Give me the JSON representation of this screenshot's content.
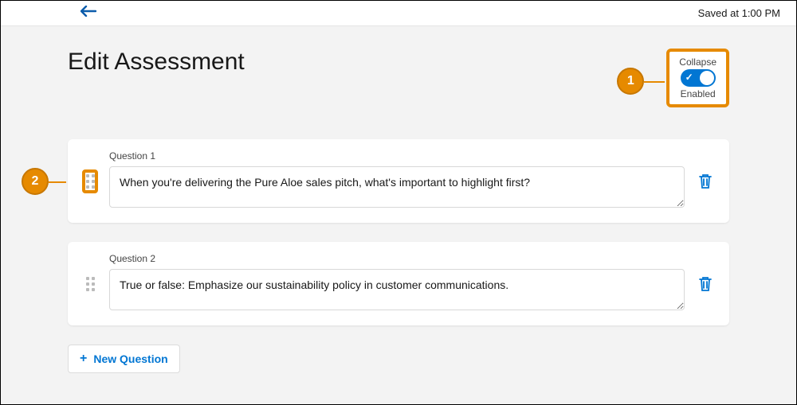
{
  "topbar": {
    "saved_text": "Saved at 1:00 PM"
  },
  "page": {
    "title": "Edit Assessment"
  },
  "collapse": {
    "label": "Collapse",
    "state_label": "Enabled"
  },
  "callouts": {
    "one": "1",
    "two": "2"
  },
  "questions": [
    {
      "label": "Question 1",
      "text": "When you're delivering the Pure Aloe sales pitch, what's important to highlight first?"
    },
    {
      "label": "Question 2",
      "text": "True or false: Emphasize our sustainability policy in customer communications."
    }
  ],
  "buttons": {
    "new_question": "New Question"
  }
}
